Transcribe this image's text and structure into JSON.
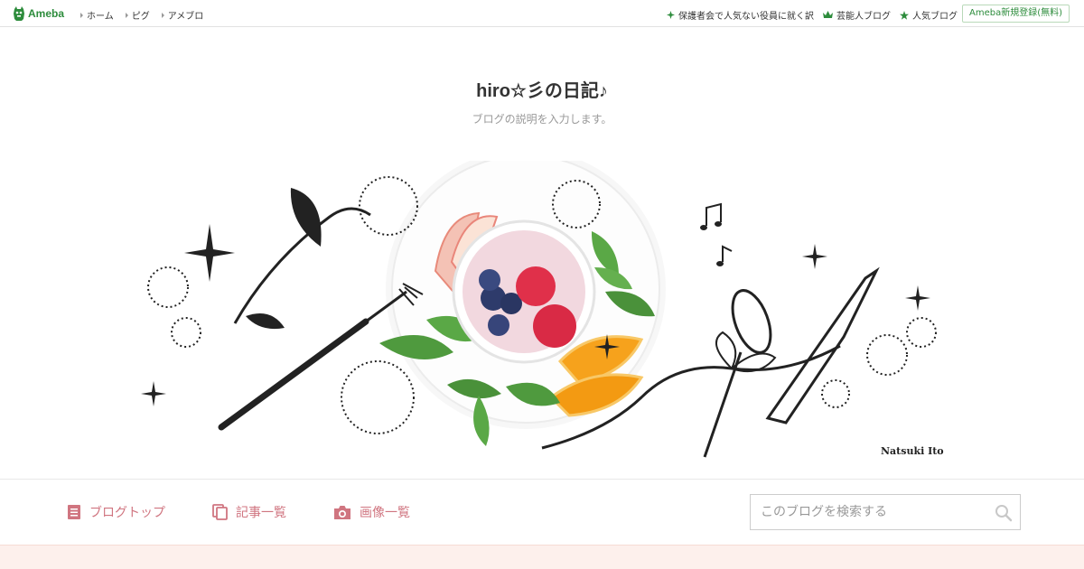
{
  "topbar": {
    "logo_text": "Ameba",
    "left_links": [
      {
        "label": "ホーム"
      },
      {
        "label": "ピグ"
      },
      {
        "label": "アメブロ"
      }
    ],
    "right_links": [
      {
        "label": "保護者会で人気ない役員に就く訳",
        "icon": "sparkle-icon"
      },
      {
        "label": "芸能人ブログ",
        "icon": "crown-icon"
      },
      {
        "label": "人気ブログ",
        "icon": "star-icon"
      }
    ],
    "signup_label": "Ameba新規登録(無料)"
  },
  "blog": {
    "title": "hiro☆彡の日記♪",
    "description": "ブログの説明を入力します。",
    "banner_signature": "Natsuki Ito"
  },
  "subnav": {
    "items": [
      {
        "label": "ブログトップ",
        "icon": "document-icon"
      },
      {
        "label": "記事一覧",
        "icon": "copy-icon"
      },
      {
        "label": "画像一覧",
        "icon": "camera-icon"
      }
    ]
  },
  "search": {
    "placeholder": "このブログを検索する"
  },
  "colors": {
    "brand_green": "#2d8c3c",
    "accent_pink": "#d07580",
    "footer_band": "#fdf0ec"
  }
}
